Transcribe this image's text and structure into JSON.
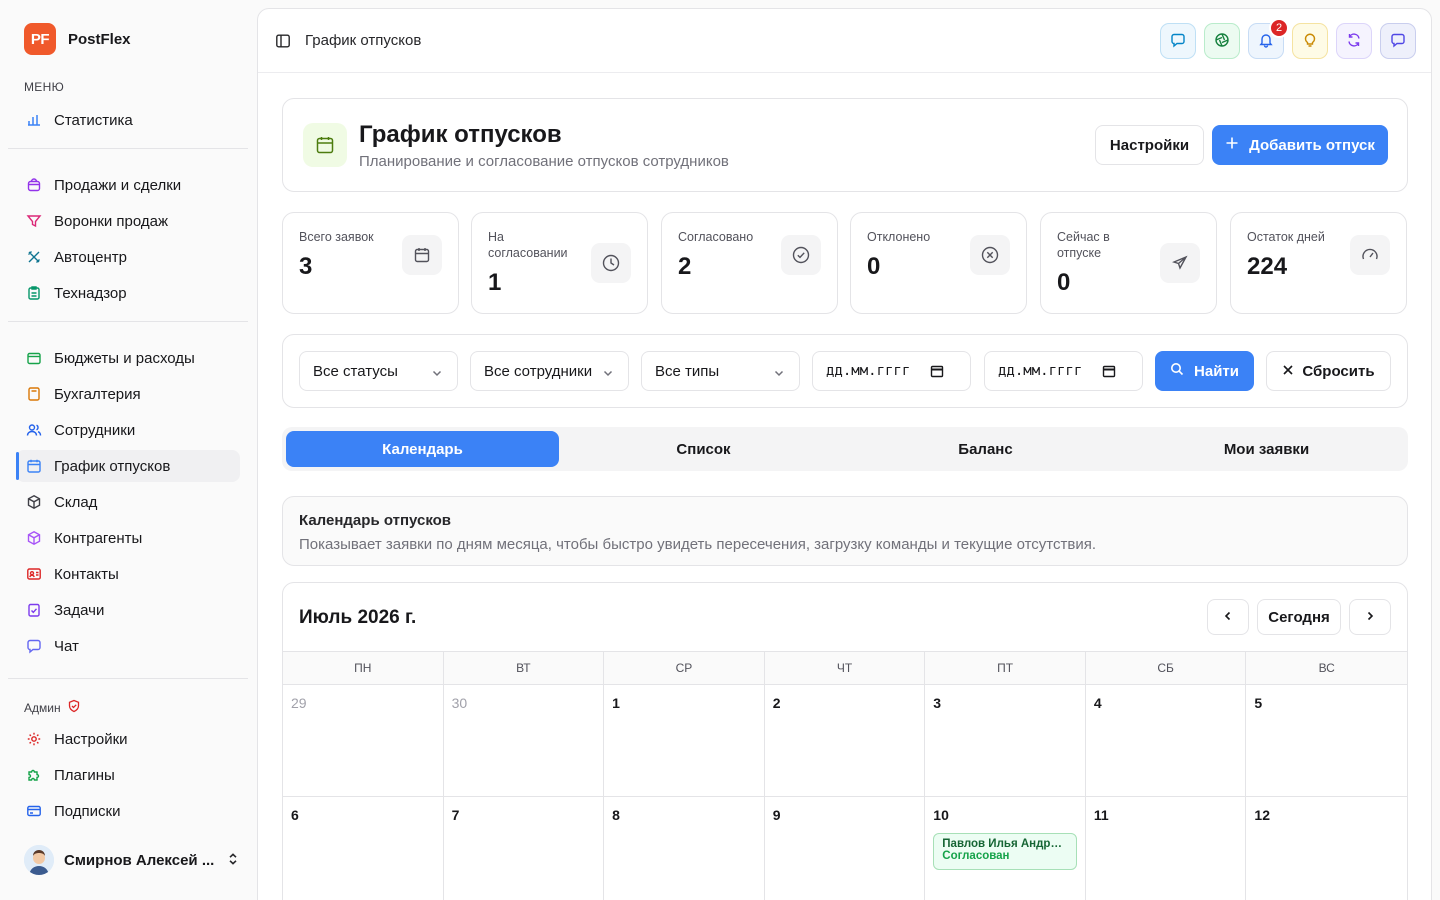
{
  "brand": {
    "logo": "PF",
    "name": "PostFlex",
    "logo_color": "#f0592b"
  },
  "sidebar": {
    "menu_caption": "МЕНЮ",
    "stats_item": {
      "label": "Статистика",
      "icon": "bar-chart-icon"
    },
    "group1": [
      {
        "label": "Продажи и сделки",
        "icon": "bag-icon"
      },
      {
        "label": "Воронки продаж",
        "icon": "funnel-icon"
      },
      {
        "label": "Автоцентр",
        "icon": "wrench-icon"
      },
      {
        "label": "Технадзор",
        "icon": "clipboard-icon"
      }
    ],
    "group2": [
      {
        "label": "Бюджеты и расходы",
        "icon": "wallet-icon"
      },
      {
        "label": "Бухгалтерия",
        "icon": "calculator-icon"
      },
      {
        "label": "Сотрудники",
        "icon": "users-icon"
      },
      {
        "label": "График отпусков",
        "icon": "calendar-icon",
        "active": true
      },
      {
        "label": "Склад",
        "icon": "box-icon"
      },
      {
        "label": "Контрагенты",
        "icon": "package-icon"
      },
      {
        "label": "Контакты",
        "icon": "contact-card-icon"
      },
      {
        "label": "Задачи",
        "icon": "task-icon"
      },
      {
        "label": "Чат",
        "icon": "chat-icon"
      }
    ],
    "admin_caption": "Админ",
    "admin": [
      {
        "label": "Настройки",
        "icon": "gear-icon"
      },
      {
        "label": "Плагины",
        "icon": "puzzle-icon"
      },
      {
        "label": "Подписки",
        "icon": "credit-card-icon"
      }
    ],
    "user": {
      "name": "Смирнов Алексей ..."
    }
  },
  "topbar": {
    "title": "График отпусков",
    "notifications_count": "2"
  },
  "header": {
    "title": "График отпусков",
    "subtitle": "Планирование и согласование отпусков сотрудников",
    "settings_label": "Настройки",
    "add_label": "Добавить отпуск"
  },
  "stats": [
    {
      "label": "Всего заявок",
      "value": "3",
      "icon": "calendar-icon"
    },
    {
      "label": "На согласовании",
      "value": "1",
      "icon": "clock-icon"
    },
    {
      "label": "Согласовано",
      "value": "2",
      "icon": "check-circle-icon"
    },
    {
      "label": "Отклонено",
      "value": "0",
      "icon": "x-circle-icon"
    },
    {
      "label": "Сейчас в отпуске",
      "value": "0",
      "icon": "plane-icon"
    },
    {
      "label": "Остаток дней",
      "value": "224",
      "icon": "gauge-icon"
    }
  ],
  "filters": {
    "status": "Все статусы",
    "employee": "Все сотрудники",
    "type": "Все типы",
    "date_from_placeholder": "дд.мм.гггг",
    "date_to_placeholder": "дд.мм.гггг",
    "search_label": "Найти",
    "reset_label": "Сбросить"
  },
  "tabs": [
    {
      "label": "Календарь",
      "active": true
    },
    {
      "label": "Список"
    },
    {
      "label": "Баланс"
    },
    {
      "label": "Мои заявки"
    }
  ],
  "info": {
    "title": "Календарь отпусков",
    "text": "Показывает заявки по дням месяца, чтобы быстро увидеть пересечения, загрузку команды и текущие отсутствия."
  },
  "calendar": {
    "month_label": "Июль 2026 г.",
    "today_label": "Сегодня",
    "weekdays": [
      "ПН",
      "ВТ",
      "СР",
      "ЧТ",
      "ПТ",
      "СБ",
      "ВС"
    ],
    "weeks": [
      [
        "29",
        "30",
        "1",
        "2",
        "3",
        "4",
        "5"
      ],
      [
        "6",
        "7",
        "8",
        "9",
        "10",
        "11",
        "12"
      ]
    ],
    "event": {
      "name": "Павлов Илья Андрее...",
      "status": "Согласован"
    }
  }
}
